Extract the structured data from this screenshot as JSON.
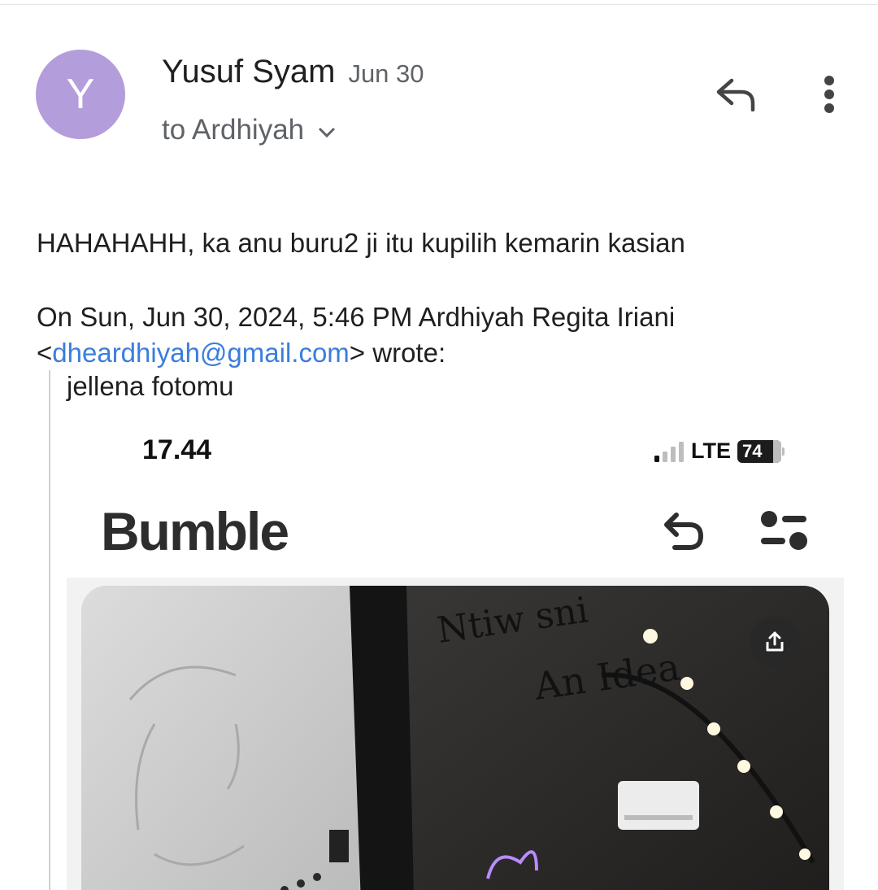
{
  "message": {
    "avatar_initial": "Y",
    "sender_name": "Yusuf Syam",
    "date": "Jun 30",
    "recipient": "to Ardhiyah",
    "body": "HAHAHAHH, ka anu buru2 ji itu kupilih kemarin kasian",
    "attribution_prefix": "On Sun, Jun 30, 2024, 5:46 PM Ardhiyah Regita Iriani",
    "attribution_email": "dheardhiyah@gmail.com",
    "attribution_suffix": "wrote:",
    "quoted_text": "jellena fotomu"
  },
  "phone_screenshot": {
    "time": "17.44",
    "network": "LTE",
    "battery": "74",
    "app_name": "Bumble",
    "photo_overlay_text": "Ntiw sni",
    "photo_overlay_text2": "An Idea"
  },
  "colors": {
    "avatar": "#b39ddb",
    "link": "#3b7ddd",
    "secondary_text": "#5f6368"
  },
  "icons": {
    "reply": "reply-icon",
    "more": "more-vert-icon",
    "chevron": "chevron-down-icon",
    "undo": "undo-icon",
    "filter": "filter-icon",
    "share": "share-icon"
  }
}
